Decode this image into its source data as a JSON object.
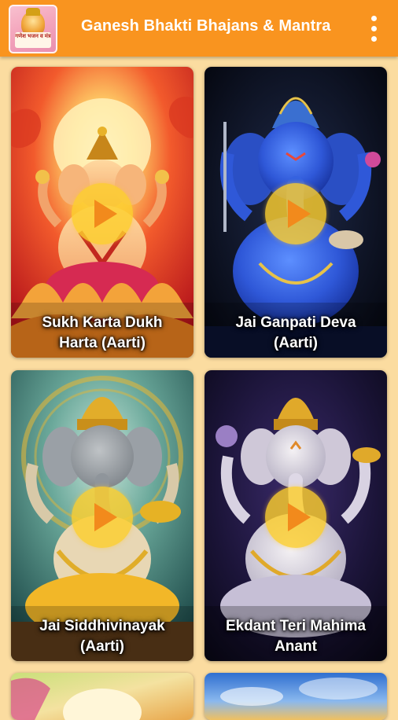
{
  "app": {
    "title": "Ganesh Bhakti Bhajans & Mantra",
    "icon_text": "गणेश भजन व मंत्र",
    "menu_icon": "more-vert-icon"
  },
  "cards": [
    {
      "line1": "Sukh Karta Dukh",
      "line2": "Harta (Aarti)",
      "icon": "play-icon"
    },
    {
      "line1": "Jai Ganpati Deva",
      "line2": "(Aarti)",
      "icon": "play-icon"
    },
    {
      "line1": "Jai Siddhivinayak",
      "line2": "(Aarti)",
      "icon": "play-icon"
    },
    {
      "line1": "Ekdant Teri Mahima",
      "line2": "Anant",
      "icon": "play-icon"
    }
  ],
  "colors": {
    "appbar": "#f9941f",
    "background": "#fbdca0",
    "play_circle": "#fcce2d",
    "play_triangle": "#f28a1c"
  }
}
